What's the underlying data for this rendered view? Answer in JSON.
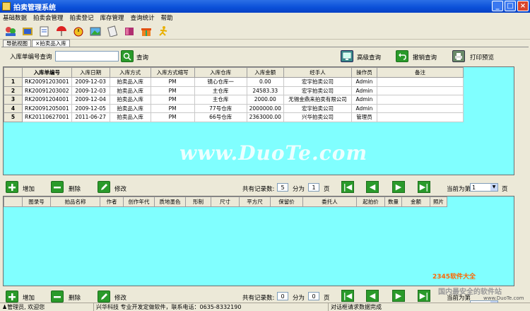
{
  "window": {
    "title": "拍卖管理系统",
    "btn_min": "_",
    "btn_max": "□",
    "btn_close": "×"
  },
  "menu": [
    "基础数据",
    "拍卖会管理",
    "拍卖登记",
    "库存管理",
    "查询统计",
    "帮助"
  ],
  "toolbar_icons": [
    "people-icon",
    "books-icon",
    "notes-icon",
    "umbrella-icon",
    "alarm-clock-icon",
    "picture-icon",
    "notepad-icon",
    "book-icon",
    "gift-icon",
    "runner-icon"
  ],
  "tabs": [
    {
      "label": "导航视图"
    },
    {
      "label": "×拍卖品入库"
    }
  ],
  "query": {
    "label": "入库单编号查询",
    "value": "",
    "search_label": "查询",
    "advanced_label": "高级查询",
    "cancel_label": "撤销查询",
    "print_label": "打印预览"
  },
  "upper_table": {
    "columns": [
      "入库单编号",
      "入库日期",
      "入库方式",
      "入库方式缩写",
      "入库仓库",
      "入库金额",
      "经手人",
      "操作员",
      "备注"
    ],
    "rows": [
      {
        "n": "1",
        "cells": [
          "RK20091203001",
          "2009-12-03",
          "拍卖品入库",
          "PM",
          "镜心仓库一",
          "0.00",
          "宏宇拍卖公司",
          "Admin",
          ""
        ]
      },
      {
        "n": "2",
        "cells": [
          "RK20091203002",
          "2009-12-03",
          "拍卖品入库",
          "PM",
          "主仓库",
          "24583.33",
          "宏宇拍卖公司",
          "Admin",
          ""
        ]
      },
      {
        "n": "3",
        "cells": [
          "RK20091204001",
          "2009-12-04",
          "拍卖品入库",
          "PM",
          "主仓库",
          "2000.00",
          "无锡金鼎来拍卖有限公司",
          "Admin",
          ""
        ]
      },
      {
        "n": "4",
        "cells": [
          "RK20091205001",
          "2009-12-05",
          "拍卖品入库",
          "PM",
          "77号仓库",
          "2000000.00",
          "宏宇拍卖公司",
          "Admin",
          ""
        ]
      },
      {
        "n": "5",
        "cells": [
          "RK20110627001",
          "2011-06-27",
          "拍卖品入库",
          "PM",
          "66号仓库",
          "2363000.00",
          "兴华拍卖公司",
          "管理员",
          ""
        ]
      }
    ]
  },
  "upper_bar": {
    "add_label": "增加",
    "delete_label": "删除",
    "edit_label": "修改",
    "total_label": "共有记录数:",
    "total": "5",
    "pages_label": "分为",
    "pages": "1",
    "page_unit": "页",
    "current_label": "当前为第",
    "current": "1",
    "current_unit": "页"
  },
  "lower_table": {
    "columns": [
      "图录号",
      "拍品名称",
      "作者",
      "创作年代",
      "质地墨色",
      "形制",
      "尺寸",
      "平方尺",
      "保留价",
      "委托人",
      "起拍价",
      "数量",
      "金额",
      "照片"
    ]
  },
  "lower_bar": {
    "add_label": "增加",
    "delete_label": "删除",
    "edit_label": "修改",
    "total_label": "共有记录数:",
    "total": "0",
    "pages_label": "分为",
    "pages": "0",
    "page_unit": "页",
    "current_label": "当前为第"
  },
  "status": {
    "user": "管理员, 欢迎您",
    "company": "兴华科技  专业开发定做软件，联系电话：0635-8332190",
    "message": "对话框请求数据完成"
  },
  "watermarks": {
    "duote": "www.DuoTe.com",
    "brand": "2345软件大全",
    "safe": "国内最安全的软件站",
    "small": "www.DuoTe.com"
  }
}
